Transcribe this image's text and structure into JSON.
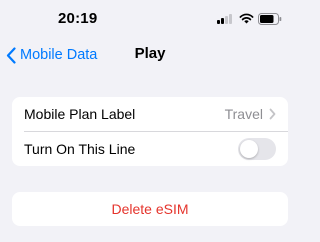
{
  "status_bar": {
    "time": "20:19",
    "signal_bars_filled": 2,
    "signal_bars_total": 4,
    "icons": [
      "signal-icon",
      "wifi-icon",
      "battery-icon"
    ]
  },
  "nav": {
    "back_label": "Mobile Data",
    "title": "Play",
    "accent_color": "#007aff"
  },
  "settings": {
    "plan_label": {
      "label": "Mobile Plan Label",
      "value": "Travel"
    },
    "line_toggle": {
      "label": "Turn On This Line",
      "on": false
    }
  },
  "actions": {
    "delete_label": "Delete eSIM",
    "delete_color": "#e5342c"
  }
}
